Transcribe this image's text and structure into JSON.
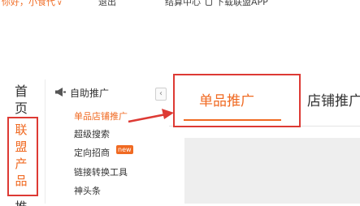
{
  "topbar": {
    "greeting": "你好，小食代",
    "logout": "退出",
    "settlement": "结算中心",
    "download_app": "下载联盟APP"
  },
  "nav": {
    "home": "首页",
    "union_products": "联盟产品",
    "partial_next": "推"
  },
  "submenu": {
    "heading": "自助推广",
    "items": [
      {
        "label": "单品店铺推广"
      },
      {
        "label": "超级搜索"
      },
      {
        "label": "定向招商"
      },
      {
        "label": "链接转换工具"
      },
      {
        "label": "神头条"
      }
    ],
    "new_badge": "new"
  },
  "tabs": [
    {
      "label": "单品推广"
    },
    {
      "label": "店铺推广"
    }
  ],
  "collapse_glyph": "‹",
  "colors": {
    "accent": "#f06a22",
    "highlight_box": "#dd3a34"
  },
  "icons": {
    "megaphone": "megaphone-icon",
    "phone": "phone-icon",
    "chevron": "chevron-down-icon"
  }
}
